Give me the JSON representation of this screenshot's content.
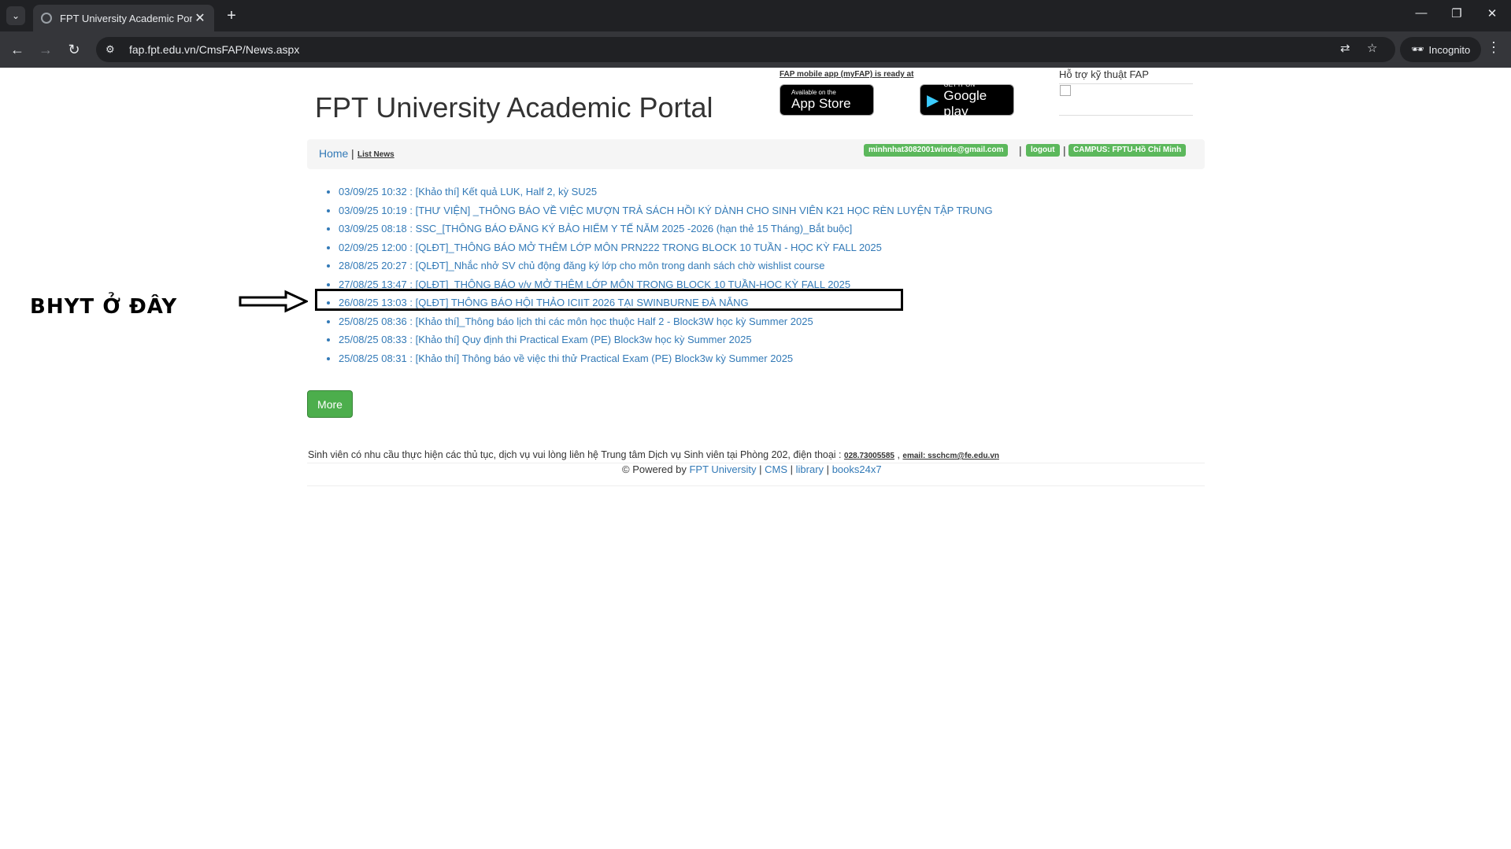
{
  "browser": {
    "tab_title": "FPT University Academic Portal",
    "url": "fap.fpt.edu.vn/CmsFAP/News.aspx",
    "incognito_label": "Incognito"
  },
  "header": {
    "site_title": "FPT University Academic Portal",
    "mobile_app_label": "FAP mobile app (myFAP) is ready at",
    "app_store_small": "Available on the",
    "app_store_big": "App Store",
    "google_play_small": "GET IT ON",
    "google_play_big": "Google play",
    "support_label": "Hỗ trợ kỹ thuật FAP"
  },
  "breadcrumb": {
    "home": "Home",
    "separator": "|",
    "current": "List News",
    "user_email": "minhnhat3082001winds@gmail.com",
    "logout": "logout",
    "campus": "CAMPUS: FPTU-Hồ Chí Minh"
  },
  "news": [
    "03/09/25 10:32 : [Khảo thí] Kết quả LUK, Half 2, kỳ SU25",
    "03/09/25 10:19 : [THƯ VIỆN] _THÔNG BÁO VỀ VIỆC MƯỢN TRẢ SÁCH HỒI KÝ DÀNH CHO SINH VIÊN K21 HỌC RÈN LUYỆN TẬP TRUNG",
    "03/09/25 08:18 : SSC_[THÔNG BÁO ĐĂNG KÝ BẢO HIỂM Y TẾ NĂM 2025 -2026 (hạn thẻ 15 Tháng)_Bắt buộc]",
    "02/09/25 12:00 : [QLĐT]_THÔNG BÁO MỞ THÊM LỚP MÔN PRN222 TRONG BLOCK 10 TUẦN - HỌC KỲ FALL 2025",
    "28/08/25 20:27 : [QLĐT]_Nhắc nhở SV chủ động đăng ký lớp cho môn trong danh sách chờ wishlist course",
    "27/08/25 13:47 : [QLĐT]_THÔNG BÁO v/v MỞ THÊM LỚP MÔN TRONG BLOCK 10 TUẦN-HỌC KỲ FALL 2025",
    "26/08/25 13:03 : [QLĐT] THÔNG BÁO HỘI THẢO ICIIT 2026 TẠI SWINBURNE ĐÀ NẴNG",
    "25/08/25 08:36 : [Khảo thí]_Thông báo lịch thi các môn học thuộc Half 2 - Block3W học kỳ Summer 2025",
    "25/08/25 08:33 : [Khảo thí] Quy định thi Practical Exam (PE) Block3w học kỳ Summer 2025",
    "25/08/25 08:31 : [Khảo thí] Thông báo về việc thi thử Practical Exam (PE) Block3w kỳ Summer 2025"
  ],
  "annotation": {
    "text": "BHYT Ở ĐÂY"
  },
  "more_button": "More",
  "footer": {
    "contact_text": "Sinh viên có nhu cầu thực hiện các thủ tục, dịch vụ vui lòng liên hệ Trung tâm Dịch vụ Sinh viên tại Phòng 202, điện thoại :",
    "phone": "028.73005585",
    "comma": " , ",
    "email": "email: sschcm@fe.edu.vn",
    "powered_by": "© Powered by",
    "link_fpt": "FPT University",
    "link_cms": "CMS",
    "link_library": "library",
    "link_books": "books24x7"
  },
  "colors": {
    "link": "#337ab7",
    "label_green": "#5cb85c",
    "button_green": "#4cae4c"
  }
}
